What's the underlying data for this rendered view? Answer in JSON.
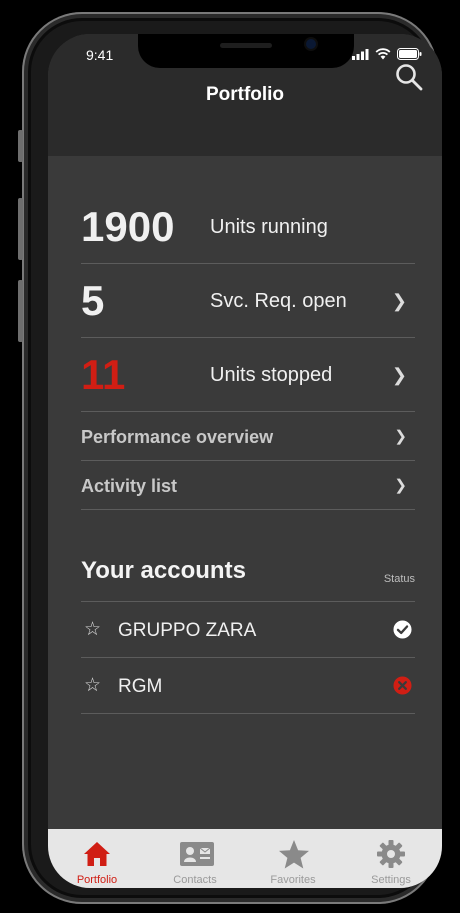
{
  "status_bar": {
    "time": "9:41"
  },
  "header": {
    "title": "Portfolio"
  },
  "summary": [
    {
      "value": "1900",
      "label": "Units running",
      "color": "#f0f0f0",
      "has_chevron": false
    },
    {
      "value": "5",
      "label": "Svc. Req. open",
      "color": "#f0f0f0",
      "has_chevron": true
    },
    {
      "value": "11",
      "label": "Units stopped",
      "color": "#d01e14",
      "has_chevron": true
    }
  ],
  "links": [
    {
      "label": "Performance overview"
    },
    {
      "label": "Activity list"
    }
  ],
  "accounts": {
    "title": "Your accounts",
    "status_header": "Status",
    "items": [
      {
        "name": "GRUPPO ZARA",
        "status": "ok",
        "status_icon": "check-circle-icon"
      },
      {
        "name": "RGM",
        "status": "error",
        "status_icon": "error-circle-icon"
      }
    ]
  },
  "tabs": [
    {
      "label": "Portfolio",
      "icon": "home-icon",
      "active": true
    },
    {
      "label": "Contacts",
      "icon": "contact-card-icon",
      "active": false
    },
    {
      "label": "Favorites",
      "icon": "star-icon",
      "active": false
    },
    {
      "label": "Settings",
      "icon": "gear-icon",
      "active": false
    }
  ],
  "colors": {
    "accent": "#d01e14",
    "background": "#3a3a3a",
    "header": "#2b2b2b",
    "tabbar": "#e6e6e6",
    "ok": "#ffffff"
  }
}
